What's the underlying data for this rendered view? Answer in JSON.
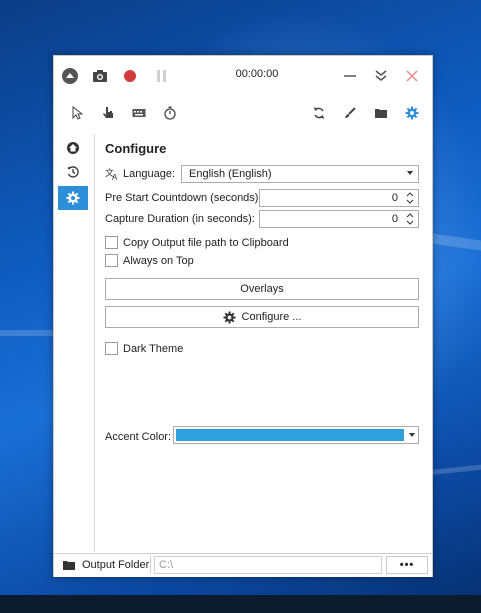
{
  "titlebar": {
    "timer": "00:00:00"
  },
  "toolbar": {
    "tools": [
      "cursor-icon",
      "hand-icon",
      "keyboard-icon",
      "stopwatch-icon"
    ],
    "right_tools": [
      "refresh-icon",
      "brush-icon",
      "folder-icon",
      "gear-icon"
    ]
  },
  "sidebar": {
    "items": [
      "home-icon",
      "history-icon",
      "gear-icon"
    ],
    "active_index": 2
  },
  "configure": {
    "heading": "Configure",
    "language_label": "Language:",
    "language_value": "English (English)",
    "pre_start_label": "Pre Start Countdown (seconds):",
    "pre_start_value": "0",
    "capture_duration_label": "Capture Duration (in seconds):",
    "capture_duration_value": "0",
    "copy_output_label": "Copy Output file path to Clipboard",
    "always_on_top_label": "Always on Top",
    "overlays_button": "Overlays",
    "configure_button": "Configure ...",
    "dark_theme_label": "Dark Theme",
    "accent_label": "Accent Color:",
    "accent_color": "#2ea0dc"
  },
  "footer": {
    "output_folder_label": "Output Folder",
    "output_path": "C:\\",
    "more_label": "•••"
  },
  "colors": {
    "record": "#d23c3c",
    "active_sidebar": "#2e8fd9",
    "gear_accent": "#2e8fd9"
  }
}
